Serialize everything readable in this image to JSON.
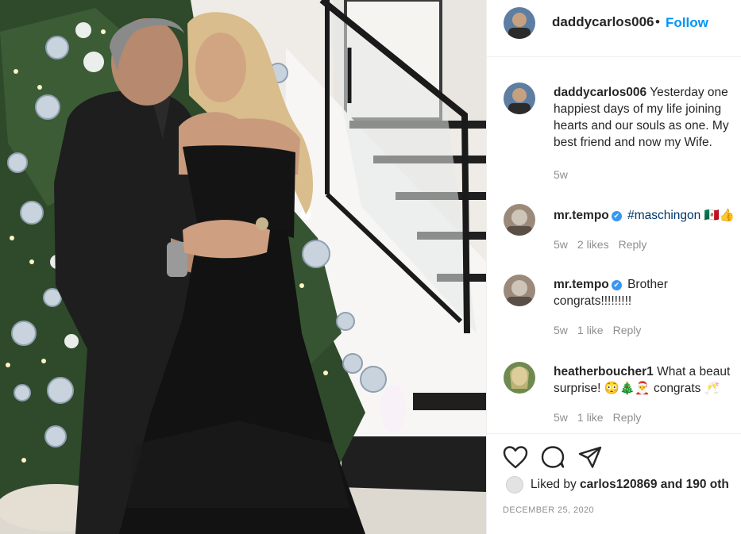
{
  "post": {
    "username": "daddycarlos006",
    "dot": "•",
    "follow_label": "Follow"
  },
  "caption": {
    "username": "daddycarlos006",
    "line1": "Yesterday one",
    "line2": "happiest days of my life joining",
    "line3": "hearts and our souls as one. My",
    "line4": "best friend and now my Wife.",
    "time": "5w"
  },
  "comments": [
    {
      "username": "mr.tempo",
      "verified": true,
      "text_line1": "#maschingon 🇲🇽👍",
      "text_line2": "",
      "time": "5w",
      "likes": "2 likes",
      "reply": "Reply"
    },
    {
      "username": "mr.tempo",
      "verified": true,
      "text_line1": "Brother",
      "text_line2": "congrats!!!!!!!!!",
      "time": "5w",
      "likes": "1 like",
      "reply": "Reply"
    },
    {
      "username": "heatherboucher1",
      "verified": false,
      "text_line1": "What a beaut",
      "text_line2": "surprise! 😳🎄🎅 congrats 🥂",
      "time": "5w",
      "likes": "1 like",
      "reply": "Reply"
    }
  ],
  "actions": {
    "liked_by_prefix": "Liked by",
    "liked_by_user": "carlos120869",
    "liked_by_suffix": "and 190 oth",
    "date": "DECEMBER 25, 2020"
  },
  "colors": {
    "link_blue": "#0095f6",
    "hashtag": "#00376b",
    "verified": "#3897f0",
    "muted": "#8e8e8e"
  },
  "icons": [
    "heart-icon",
    "comment-icon",
    "share-icon",
    "verified-badge-icon"
  ]
}
